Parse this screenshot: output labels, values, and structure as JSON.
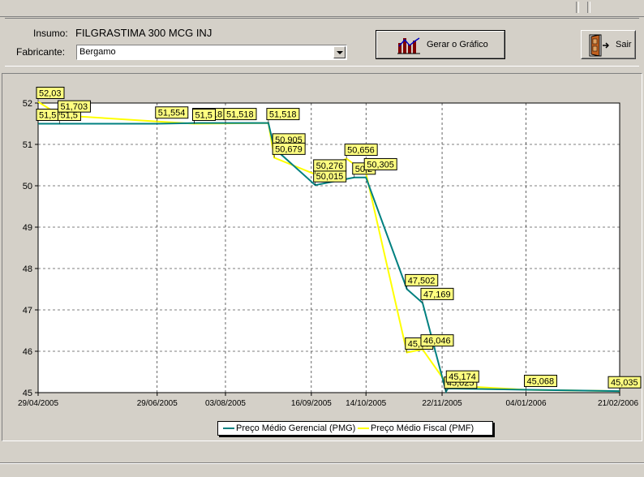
{
  "form": {
    "insumo_label": "Insumo:",
    "insumo_value": "FILGRASTIMA 300 MCG INJ",
    "fabricante_label": "Fabricante:",
    "fabricante_value": "Bergamo"
  },
  "buttons": {
    "gerar_label": "Gerar o Gráfico",
    "sair_label": "Sair"
  },
  "icons": {
    "gerar": "bar-chart-icon",
    "sair": "exit-door-icon"
  },
  "colors": {
    "pmg": "#008080",
    "pmf": "#ffff00",
    "label_bg": "#ffff80",
    "plot_bg": "#ffffff"
  },
  "chart_data": {
    "type": "line",
    "title": "",
    "ylim": [
      45,
      52
    ],
    "yticks": [
      "45",
      "46",
      "47",
      "48",
      "49",
      "50",
      "51",
      "52"
    ],
    "xlim": [
      "2005-04-29",
      "2006-02-21"
    ],
    "xticks": [
      "29/04/2005",
      "29/06/2005",
      "03/08/2005",
      "16/09/2005",
      "14/10/2005",
      "22/11/2005",
      "04/01/2006",
      "21/02/2006"
    ],
    "grid": true,
    "legend_position": "bottom",
    "series": [
      {
        "name": "Preço Médio Gerencial (PMG)",
        "color": "#008080",
        "points": [
          [
            "2005-04-29",
            51.5
          ],
          [
            "2005-05-10",
            51.5
          ],
          [
            "2005-06-29",
            51.5
          ],
          [
            "2005-07-20",
            51.518
          ],
          [
            "2005-08-03",
            51.518
          ],
          [
            "2005-08-25",
            51.518
          ],
          [
            "2005-08-28",
            50.905
          ],
          [
            "2005-09-18",
            50.015
          ],
          [
            "2005-10-08",
            50.2
          ],
          [
            "2005-10-14",
            50.2
          ],
          [
            "2005-11-04",
            47.502
          ],
          [
            "2005-11-12",
            47.169
          ],
          [
            "2005-11-24",
            45.025
          ],
          [
            "2005-11-25",
            45.1
          ],
          [
            "2006-02-21",
            45.035
          ]
        ],
        "labels": [
          {
            "x": "2005-04-29",
            "y": 51.5,
            "text": "51,5"
          },
          {
            "x": "2005-05-10",
            "y": 51.5,
            "text": "51,5"
          },
          {
            "x": "2005-07-18",
            "y": 51.518,
            "text": "51,518"
          },
          {
            "x": "2005-08-03",
            "y": 51.518,
            "text": "51,518"
          },
          {
            "x": "2005-08-25",
            "y": 51.518,
            "text": "51,518"
          },
          {
            "x": "2005-08-28",
            "y": 50.905,
            "text": "50,905"
          },
          {
            "x": "2005-09-18",
            "y": 50.015,
            "text": "50,015"
          },
          {
            "x": "2005-10-08",
            "y": 50.2,
            "text": "50,2"
          },
          {
            "x": "2005-11-04",
            "y": 47.502,
            "text": "47,502"
          },
          {
            "x": "2005-11-12",
            "y": 47.169,
            "text": "47,169"
          },
          {
            "x": "2005-11-24",
            "y": 45.025,
            "text": "45,025"
          }
        ]
      },
      {
        "name": "Preço Médio Fiscal (PMF)",
        "color": "#ffff00",
        "points": [
          [
            "2005-04-29",
            52.03
          ],
          [
            "2005-05-10",
            51.703
          ],
          [
            "2005-06-29",
            51.554
          ],
          [
            "2005-07-18",
            51.5
          ],
          [
            "2005-08-25",
            51.518
          ],
          [
            "2005-08-28",
            50.679
          ],
          [
            "2005-09-18",
            50.276
          ],
          [
            "2005-10-04",
            50.656
          ],
          [
            "2005-10-14",
            50.305
          ],
          [
            "2005-11-04",
            45.97
          ],
          [
            "2005-11-12",
            46.046
          ],
          [
            "2005-11-25",
            45.174
          ],
          [
            "2006-01-04",
            45.068
          ],
          [
            "2006-02-21",
            45.035
          ]
        ],
        "labels": [
          {
            "x": "2005-04-29",
            "y": 52.03,
            "text": "52,03"
          },
          {
            "x": "2005-05-10",
            "y": 51.703,
            "text": "51,703"
          },
          {
            "x": "2005-06-29",
            "y": 51.554,
            "text": "51,554"
          },
          {
            "x": "2005-07-18",
            "y": 51.5,
            "text": "51,5"
          },
          {
            "x": "2005-08-28",
            "y": 50.679,
            "text": "50,679"
          },
          {
            "x": "2005-09-18",
            "y": 50.276,
            "text": "50,276"
          },
          {
            "x": "2005-10-04",
            "y": 50.656,
            "text": "50,656"
          },
          {
            "x": "2005-10-14",
            "y": 50.305,
            "text": "50,305"
          },
          {
            "x": "2005-11-04",
            "y": 45.97,
            "text": "45,97"
          },
          {
            "x": "2005-11-12",
            "y": 46.046,
            "text": "46,046"
          },
          {
            "x": "2005-11-25",
            "y": 45.174,
            "text": "45,174"
          },
          {
            "x": "2006-01-04",
            "y": 45.068,
            "text": "45,068"
          },
          {
            "x": "2006-02-21",
            "y": 45.035,
            "text": "45,035"
          }
        ]
      }
    ]
  }
}
